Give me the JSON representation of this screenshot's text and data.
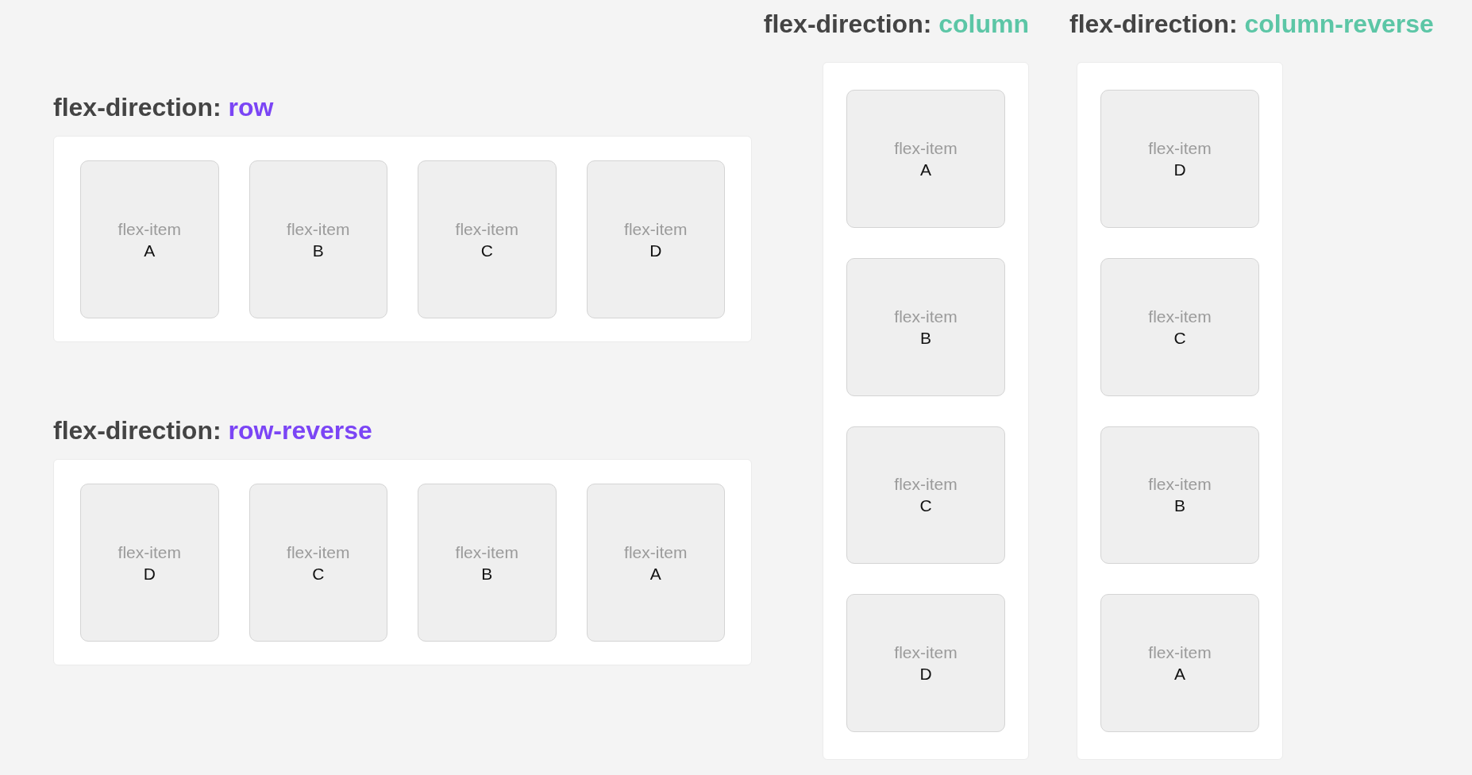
{
  "rows": [
    {
      "label": "flex-direction:",
      "value": "row",
      "color": "#7b45f5",
      "items": [
        {
          "label": "flex-item",
          "letter": "A"
        },
        {
          "label": "flex-item",
          "letter": "B"
        },
        {
          "label": "flex-item",
          "letter": "C"
        },
        {
          "label": "flex-item",
          "letter": "D"
        }
      ]
    },
    {
      "label": "flex-direction:",
      "value": "row-reverse",
      "color": "#7b45f5",
      "items": [
        {
          "label": "flex-item",
          "letter": "D"
        },
        {
          "label": "flex-item",
          "letter": "C"
        },
        {
          "label": "flex-item",
          "letter": "B"
        },
        {
          "label": "flex-item",
          "letter": "A"
        }
      ]
    }
  ],
  "columns": [
    {
      "label": "flex-direction:",
      "value": "column",
      "color": "#5cc6a6",
      "items": [
        {
          "label": "flex-item",
          "letter": "A"
        },
        {
          "label": "flex-item",
          "letter": "B"
        },
        {
          "label": "flex-item",
          "letter": "C"
        },
        {
          "label": "flex-item",
          "letter": "D"
        }
      ]
    },
    {
      "label": "flex-direction:",
      "value": "column-reverse",
      "color": "#5cc6a6",
      "items": [
        {
          "label": "flex-item",
          "letter": "D"
        },
        {
          "label": "flex-item",
          "letter": "C"
        },
        {
          "label": "flex-item",
          "letter": "B"
        },
        {
          "label": "flex-item",
          "letter": "A"
        }
      ]
    }
  ]
}
